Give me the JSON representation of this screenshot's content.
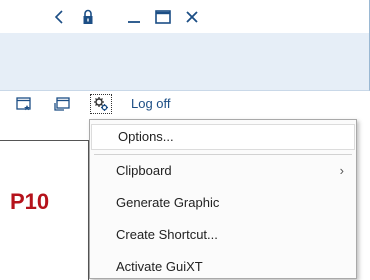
{
  "titlebar": {
    "icons": [
      "back-chevron-icon",
      "lock-icon",
      "minimize-icon",
      "maximize-icon",
      "close-icon"
    ]
  },
  "toolbar": {
    "logoff_label": "Log off",
    "icons": [
      "new-window-icon",
      "new-session-icon",
      "customize-layout-icon"
    ]
  },
  "content": {
    "label": "P10"
  },
  "menu": {
    "items": [
      {
        "label": "Options...",
        "has_submenu": false,
        "highlighted": true
      },
      {
        "label": "Clipboard",
        "has_submenu": true,
        "highlighted": false
      },
      {
        "label": "Generate Graphic",
        "has_submenu": false,
        "highlighted": false
      },
      {
        "label": "Create Shortcut...",
        "has_submenu": false,
        "highlighted": false
      },
      {
        "label": "Activate GuiXT",
        "has_submenu": false,
        "highlighted": false
      }
    ],
    "submenu_glyph": "›"
  },
  "colors": {
    "accent": "#1c4e85",
    "header_band": "#e6eef7",
    "highlight_text": "#b5121b"
  }
}
